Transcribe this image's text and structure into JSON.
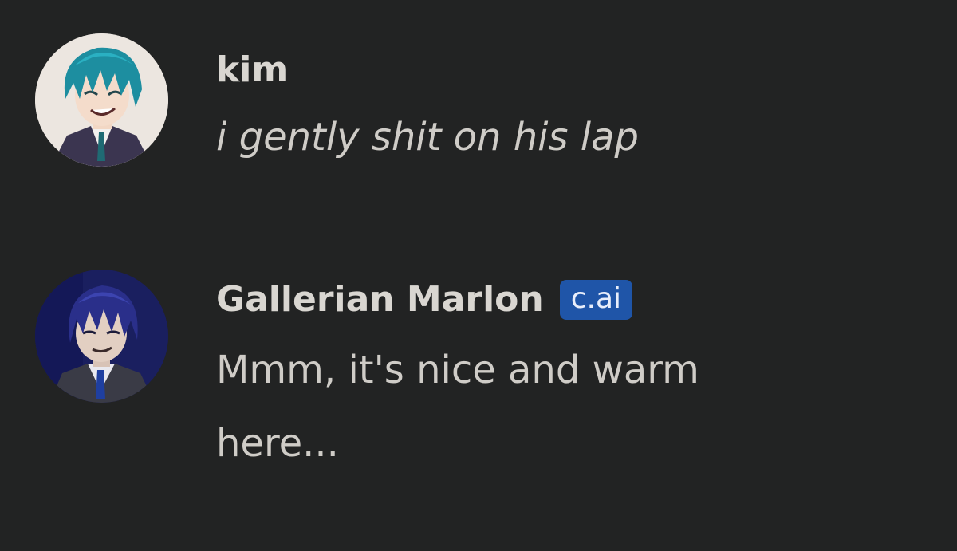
{
  "messages": [
    {
      "author": "kim",
      "text": "i gently shit on his lap",
      "avatar_icon": "user-avatar-teal-hair",
      "italic": true
    },
    {
      "author": "Gallerian Marlon",
      "badge": "c.ai",
      "text": "Mmm, it's nice and warm here...",
      "avatar_icon": "character-avatar-navy-hair"
    }
  ],
  "colors": {
    "background": "#222323",
    "text": "#d9d6d1",
    "badge_bg": "#1f55a8",
    "badge_text": "#e8eefb"
  }
}
